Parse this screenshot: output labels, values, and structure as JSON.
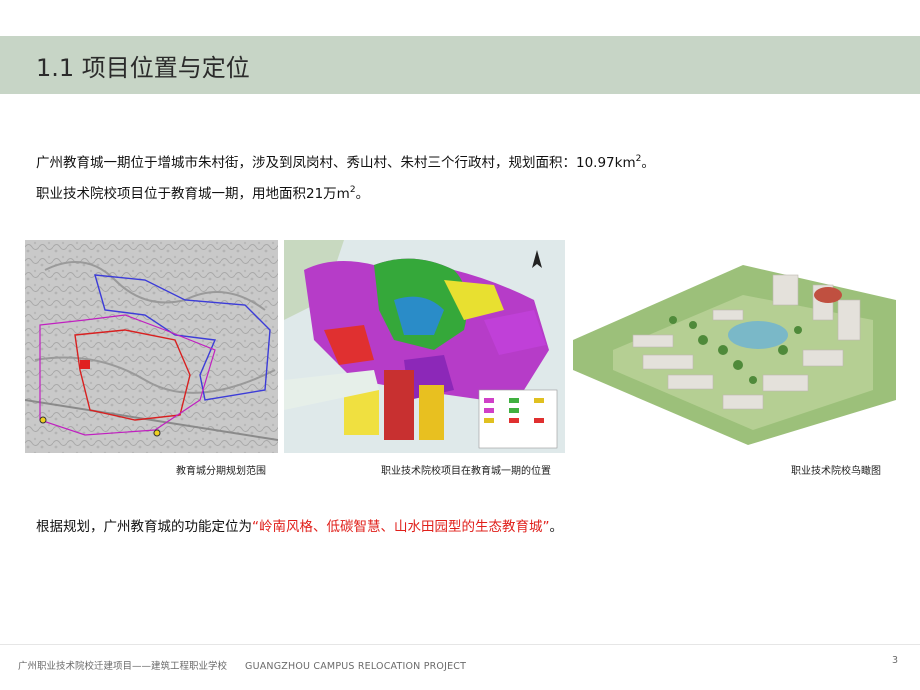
{
  "title": "1.1 项目位置与定位",
  "intro": {
    "line1": "广州教育城一期位于增城市朱村街，涉及到凤岗村、秀山村、朱村三个行政村，规划面积：10.97km",
    "line1_sup": "2",
    "line1_end": "。",
    "line2": "职业技术院校项目位于教育城一期，用地面积21万m",
    "line2_sup": "2",
    "line2_end": "。"
  },
  "captions": {
    "map1": "教育城分期规划范围",
    "map2": "职业技术院校项目在教育城一期的位置",
    "map3": "职业技术院校鸟瞰图"
  },
  "positioning": {
    "prefix": "根据规划，广州教育城的功能定位为",
    "highlight": "“岭南风格、低碳智慧、山水田园型的生态教育城”",
    "suffix": "。"
  },
  "footer": {
    "cn": "广州职业技术院校迁建项目——建筑工程职业学校",
    "en": "GUANGZHOU CAMPUS RELOCATION PROJECT",
    "page": "3"
  },
  "colors": {
    "title_band": "#c7d5c6",
    "highlight": "#e0201b"
  }
}
